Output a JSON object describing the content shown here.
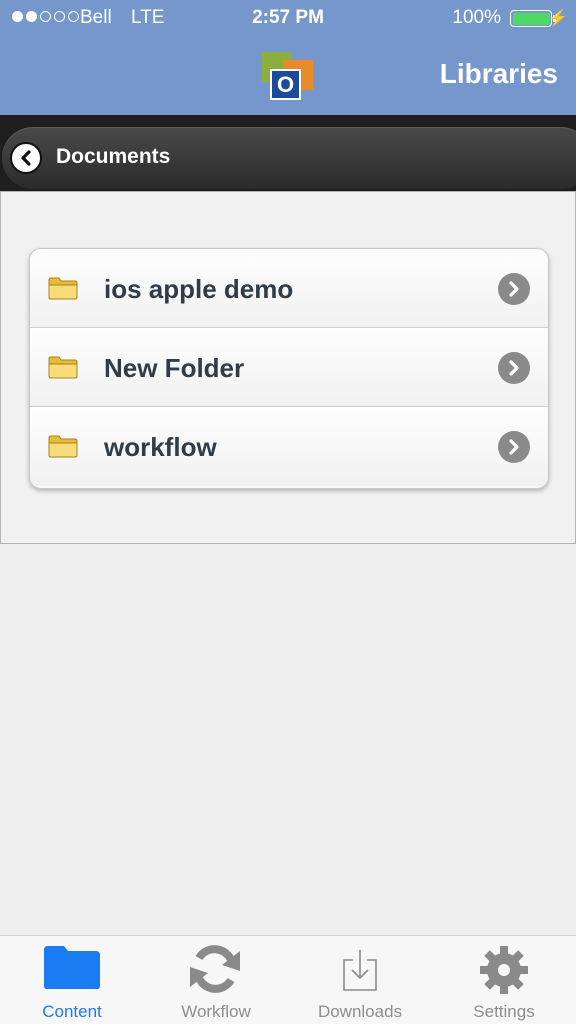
{
  "status_bar": {
    "carrier": "Bell",
    "network": "LTE",
    "time": "2:57 PM",
    "battery_percent": "100%",
    "signal_strength_dots": 2
  },
  "header": {
    "logo_letter": "O",
    "title": "Libraries"
  },
  "navigation": {
    "back_icon": "chevron-left-icon",
    "title": "Documents"
  },
  "folders": [
    {
      "label": "ios apple demo",
      "icon": "folder-icon"
    },
    {
      "label": "New Folder",
      "icon": "folder-icon"
    },
    {
      "label": "workflow",
      "icon": "folder-icon"
    }
  ],
  "tabs": [
    {
      "label": "Content",
      "icon": "folder-icon",
      "active": true
    },
    {
      "label": "Workflow",
      "icon": "refresh-icon",
      "active": false
    },
    {
      "label": "Downloads",
      "icon": "download-icon",
      "active": false
    },
    {
      "label": "Settings",
      "icon": "gear-icon",
      "active": false
    }
  ],
  "colors": {
    "header_blue": "#7597cc",
    "active_tab": "#1a7bf2",
    "battery_green": "#4cd964"
  }
}
